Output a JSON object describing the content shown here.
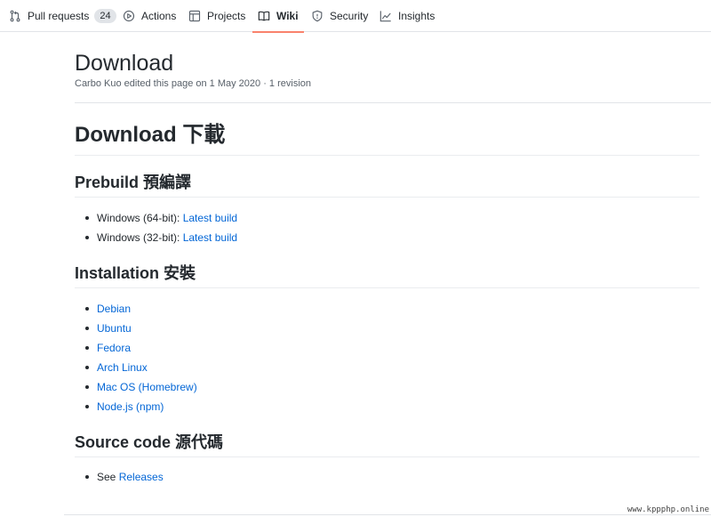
{
  "nav": {
    "tabs": [
      {
        "label": "Pull requests",
        "icon": "pull-request-icon",
        "counter": "24"
      },
      {
        "label": "Actions",
        "icon": "play-icon"
      },
      {
        "label": "Projects",
        "icon": "project-icon"
      },
      {
        "label": "Wiki",
        "icon": "book-icon",
        "selected": true
      },
      {
        "label": "Security",
        "icon": "shield-icon"
      },
      {
        "label": "Insights",
        "icon": "graph-icon"
      }
    ],
    "accent_color": "#f9826c"
  },
  "page": {
    "title": "Download",
    "meta": "Carbo Kuo edited this page on 1 May 2020 · 1 revision"
  },
  "content": {
    "h1": "Download 下載",
    "prebuild": {
      "heading": "Prebuild 預編譯",
      "items": [
        {
          "prefix": "Windows (64-bit): ",
          "link": "Latest build"
        },
        {
          "prefix": "Windows (32-bit): ",
          "link": "Latest build"
        }
      ]
    },
    "installation": {
      "heading": "Installation 安裝",
      "items": [
        "Debian",
        "Ubuntu",
        "Fedora",
        "Arch Linux",
        "Mac OS (Homebrew)",
        "Node.js (npm)"
      ]
    },
    "source": {
      "heading": "Source code 源代碼",
      "prefix": "See ",
      "link": "Releases"
    },
    "link_color": "#0366d6"
  },
  "watermark": "www.kppphp.online"
}
